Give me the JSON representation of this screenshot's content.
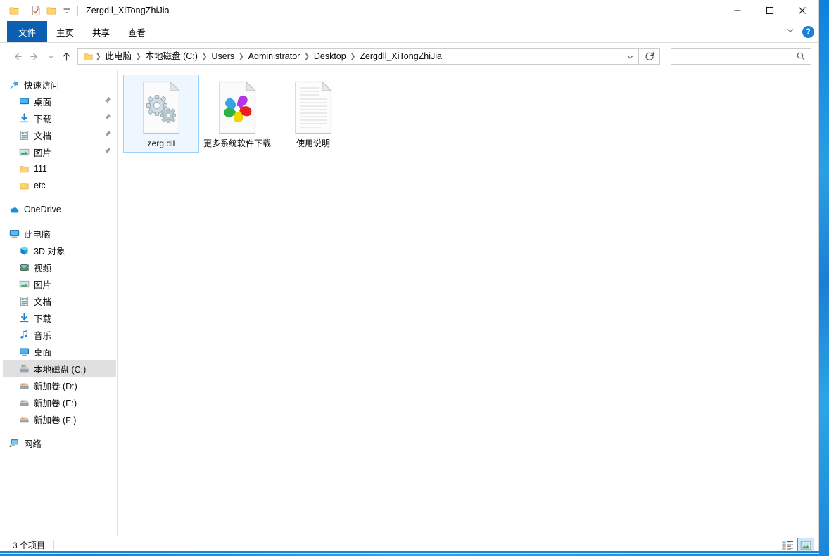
{
  "window": {
    "title": "Zergdll_XiTongZhiJia",
    "quick_access": [
      {
        "name": "folder-icon",
        "label": "文件夹"
      },
      {
        "name": "properties-icon",
        "label": "属性"
      },
      {
        "name": "new-folder-icon",
        "label": "新建文件夹"
      },
      {
        "name": "customize-dropdown-icon",
        "label": "自定义快速访问工具栏"
      }
    ],
    "controls": {
      "minimize": "—",
      "maximize": "□",
      "close": "✕"
    }
  },
  "ribbon": {
    "tabs": [
      {
        "label": "文件",
        "active": true
      },
      {
        "label": "主页",
        "active": false
      },
      {
        "label": "共享",
        "active": false
      },
      {
        "label": "查看",
        "active": false
      }
    ],
    "expand_label": "⌄",
    "help_label": "?"
  },
  "navigation": {
    "back_label": "←",
    "forward_label": "→",
    "history_label": "⌄",
    "up_label": "↑",
    "refresh_label": "↻",
    "address_dropdown_label": "⌄",
    "breadcrumbs": [
      "此电脑",
      "本地磁盘 (C:)",
      "Users",
      "Administrator",
      "Desktop",
      "Zergdll_XiTongZhiJia"
    ],
    "separator": "❯"
  },
  "search": {
    "value": "",
    "placeholder": "",
    "icon": "search-icon"
  },
  "sidebar": {
    "items": [
      {
        "label": "快速访问",
        "icon": "pin-star-icon",
        "level": 0,
        "pinned": false,
        "selected": false
      },
      {
        "label": "桌面",
        "icon": "desktop-icon",
        "level": 1,
        "pinned": true,
        "selected": false
      },
      {
        "label": "下载",
        "icon": "download-icon",
        "level": 1,
        "pinned": true,
        "selected": false
      },
      {
        "label": "文档",
        "icon": "documents-icon",
        "level": 1,
        "pinned": true,
        "selected": false
      },
      {
        "label": "图片",
        "icon": "pictures-icon",
        "level": 1,
        "pinned": true,
        "selected": false
      },
      {
        "label": "111",
        "icon": "folder-icon",
        "level": 1,
        "pinned": false,
        "selected": false
      },
      {
        "label": "etc",
        "icon": "folder-icon",
        "level": 1,
        "pinned": false,
        "selected": false
      },
      {
        "label": "OneDrive",
        "icon": "onedrive-icon",
        "level": 0,
        "pinned": false,
        "selected": false,
        "gap_before": true
      },
      {
        "label": "此电脑",
        "icon": "thispc-icon",
        "level": 0,
        "pinned": false,
        "selected": false,
        "gap_before": true
      },
      {
        "label": "3D 对象",
        "icon": "3dobjects-icon",
        "level": 1,
        "pinned": false,
        "selected": false
      },
      {
        "label": "视频",
        "icon": "videos-icon",
        "level": 1,
        "pinned": false,
        "selected": false
      },
      {
        "label": "图片",
        "icon": "pictures-icon",
        "level": 1,
        "pinned": false,
        "selected": false
      },
      {
        "label": "文档",
        "icon": "documents-icon",
        "level": 1,
        "pinned": false,
        "selected": false
      },
      {
        "label": "下载",
        "icon": "download-icon",
        "level": 1,
        "pinned": false,
        "selected": false
      },
      {
        "label": "音乐",
        "icon": "music-icon",
        "level": 1,
        "pinned": false,
        "selected": false
      },
      {
        "label": "桌面",
        "icon": "desktop-icon",
        "level": 1,
        "pinned": false,
        "selected": false
      },
      {
        "label": "本地磁盘 (C:)",
        "icon": "harddrive-system-icon",
        "level": 1,
        "pinned": false,
        "selected": true
      },
      {
        "label": "新加卷 (D:)",
        "icon": "harddrive-icon",
        "level": 1,
        "pinned": false,
        "selected": false
      },
      {
        "label": "新加卷 (E:)",
        "icon": "harddrive-icon",
        "level": 1,
        "pinned": false,
        "selected": false
      },
      {
        "label": "新加卷 (F:)",
        "icon": "harddrive-icon",
        "level": 1,
        "pinned": false,
        "selected": false
      },
      {
        "label": "网络",
        "icon": "network-icon",
        "level": 0,
        "pinned": false,
        "selected": false,
        "gap_before": true
      }
    ]
  },
  "files": [
    {
      "name": "zerg.dll",
      "icon": "dll-gears-icon",
      "selected": true
    },
    {
      "name": "更多系统软件下载",
      "icon": "pinwheel-icon",
      "selected": false
    },
    {
      "name": "使用说明",
      "icon": "textfile-icon",
      "selected": false
    }
  ],
  "statusbar": {
    "item_count": "3 个项目",
    "views": [
      {
        "name": "details-view",
        "label": "详细信息",
        "active": false
      },
      {
        "name": "large-icons-view",
        "label": "大图标",
        "active": true
      }
    ]
  },
  "colors": {
    "accent": "#0c5eb1",
    "selection": "#cce8ff",
    "selection_border": "#99d1ff",
    "sidebar_selected": "#e0e0e0",
    "taskbar_accent": "#1289d8",
    "help_blue": "#1b7fd4"
  }
}
